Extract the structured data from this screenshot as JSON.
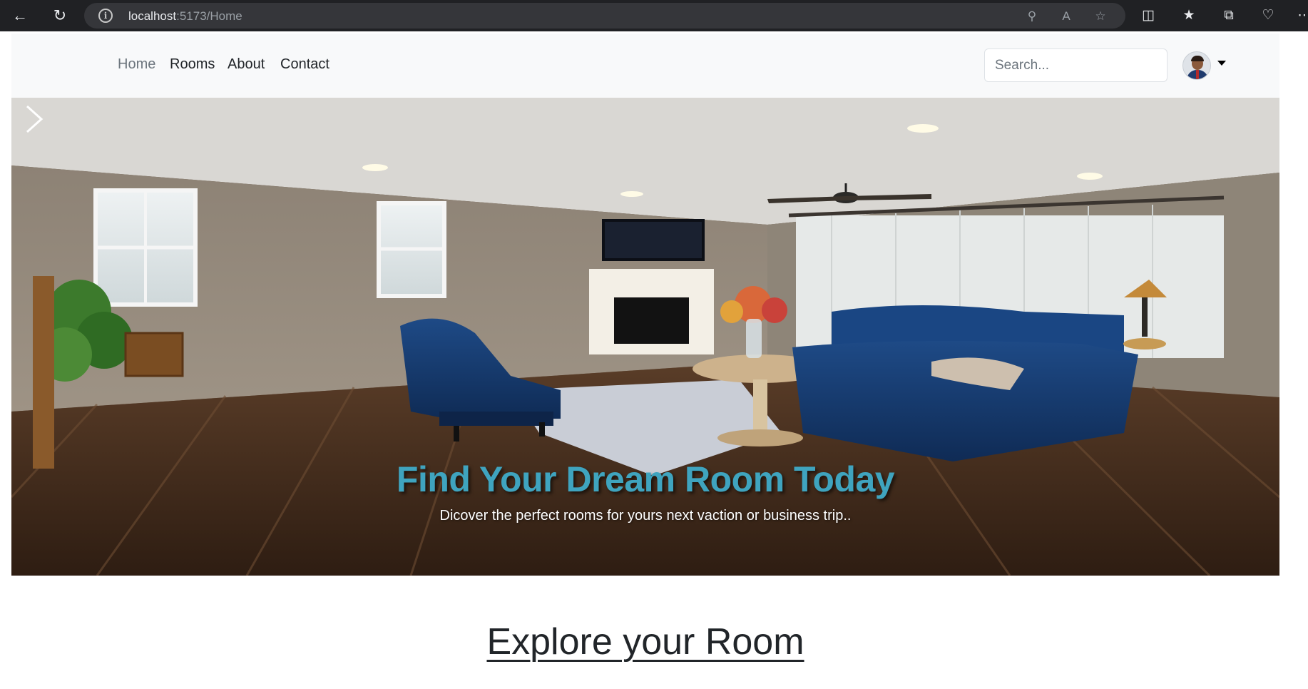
{
  "browser": {
    "url_host": "localhost",
    "url_path": ":5173/Home"
  },
  "navbar": {
    "links": [
      {
        "label": "Home",
        "active": true
      },
      {
        "label": "Rooms"
      },
      {
        "label": "About"
      },
      {
        "label": "Contact"
      }
    ],
    "search": {
      "placeholder": "Search..."
    }
  },
  "hero": {
    "title": "Find Your Dream Room Today",
    "subtitle": "Dicover the perfect rooms for yours next vaction or business trip.."
  },
  "section": {
    "title": "Explore your Room"
  },
  "colors": {
    "accent": "#3fa4bf",
    "navbar_bg": "#f8f9fa",
    "chrome_bg": "#202124"
  }
}
